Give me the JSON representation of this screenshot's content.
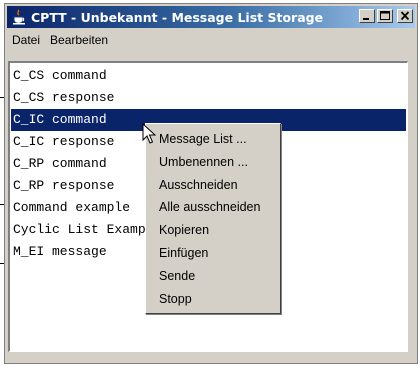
{
  "window": {
    "title": "CPTT - Unbekannt - Message List Storage",
    "icon": "java-cup-icon",
    "buttons": [
      "minimize-icon",
      "maximize-icon",
      "close-icon"
    ]
  },
  "menubar": {
    "items": [
      {
        "label": "Datei"
      },
      {
        "label": "Bearbeiten"
      }
    ]
  },
  "list": {
    "items": [
      {
        "label": "C_CS command",
        "selected": false
      },
      {
        "label": "C_CS response",
        "selected": false
      },
      {
        "label": "C_IC command",
        "selected": true
      },
      {
        "label": "C_IC response",
        "selected": false
      },
      {
        "label": "C_RP command",
        "selected": false
      },
      {
        "label": "C_RP response",
        "selected": false
      },
      {
        "label": "Command example",
        "selected": false
      },
      {
        "label": "Cyclic List Example",
        "selected": false
      },
      {
        "label": "M_EI message",
        "selected": false
      }
    ]
  },
  "context_menu": {
    "items": [
      {
        "label": "Message List ..."
      },
      {
        "label": "Umbenennen ..."
      },
      {
        "label": "Ausschneiden"
      },
      {
        "label": "Alle ausschneiden"
      },
      {
        "label": "Kopieren"
      },
      {
        "label": "Einfügen"
      },
      {
        "label": "Sende"
      },
      {
        "label": "Stopp"
      }
    ]
  },
  "colors": {
    "selection": "#0a246a",
    "titlebar_start": "#0a246a",
    "titlebar_end": "#a6caf0",
    "face": "#d4d0c8"
  }
}
